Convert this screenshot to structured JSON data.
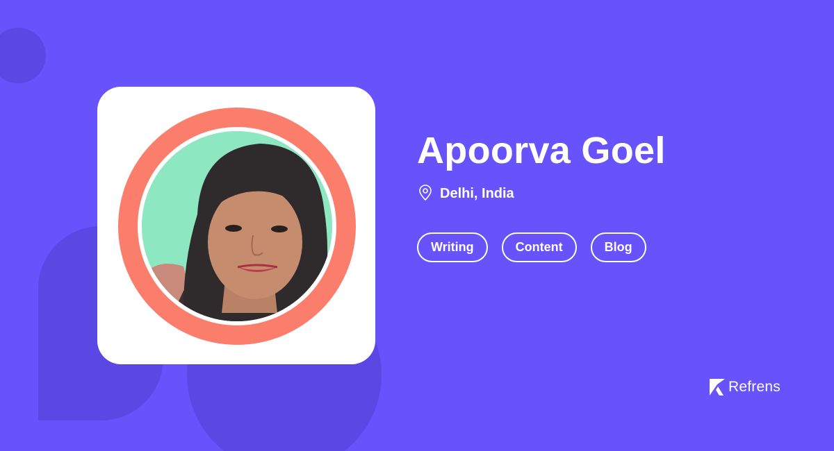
{
  "profile": {
    "name": "Apoorva Goel",
    "location": "Delhi, India",
    "tags": [
      "Writing",
      "Content",
      "Blog"
    ]
  },
  "brand": {
    "name": "Refrens"
  },
  "icons": {
    "location": "map-pin-icon",
    "brand_logo": "refrens-logo-icon"
  },
  "colors": {
    "background": "#6752fb",
    "background_shape": "#5b47e3",
    "card": "#ffffff",
    "ring": "#fb7e6c",
    "avatar_background": "#8de7c1",
    "text": "#ffffff"
  }
}
